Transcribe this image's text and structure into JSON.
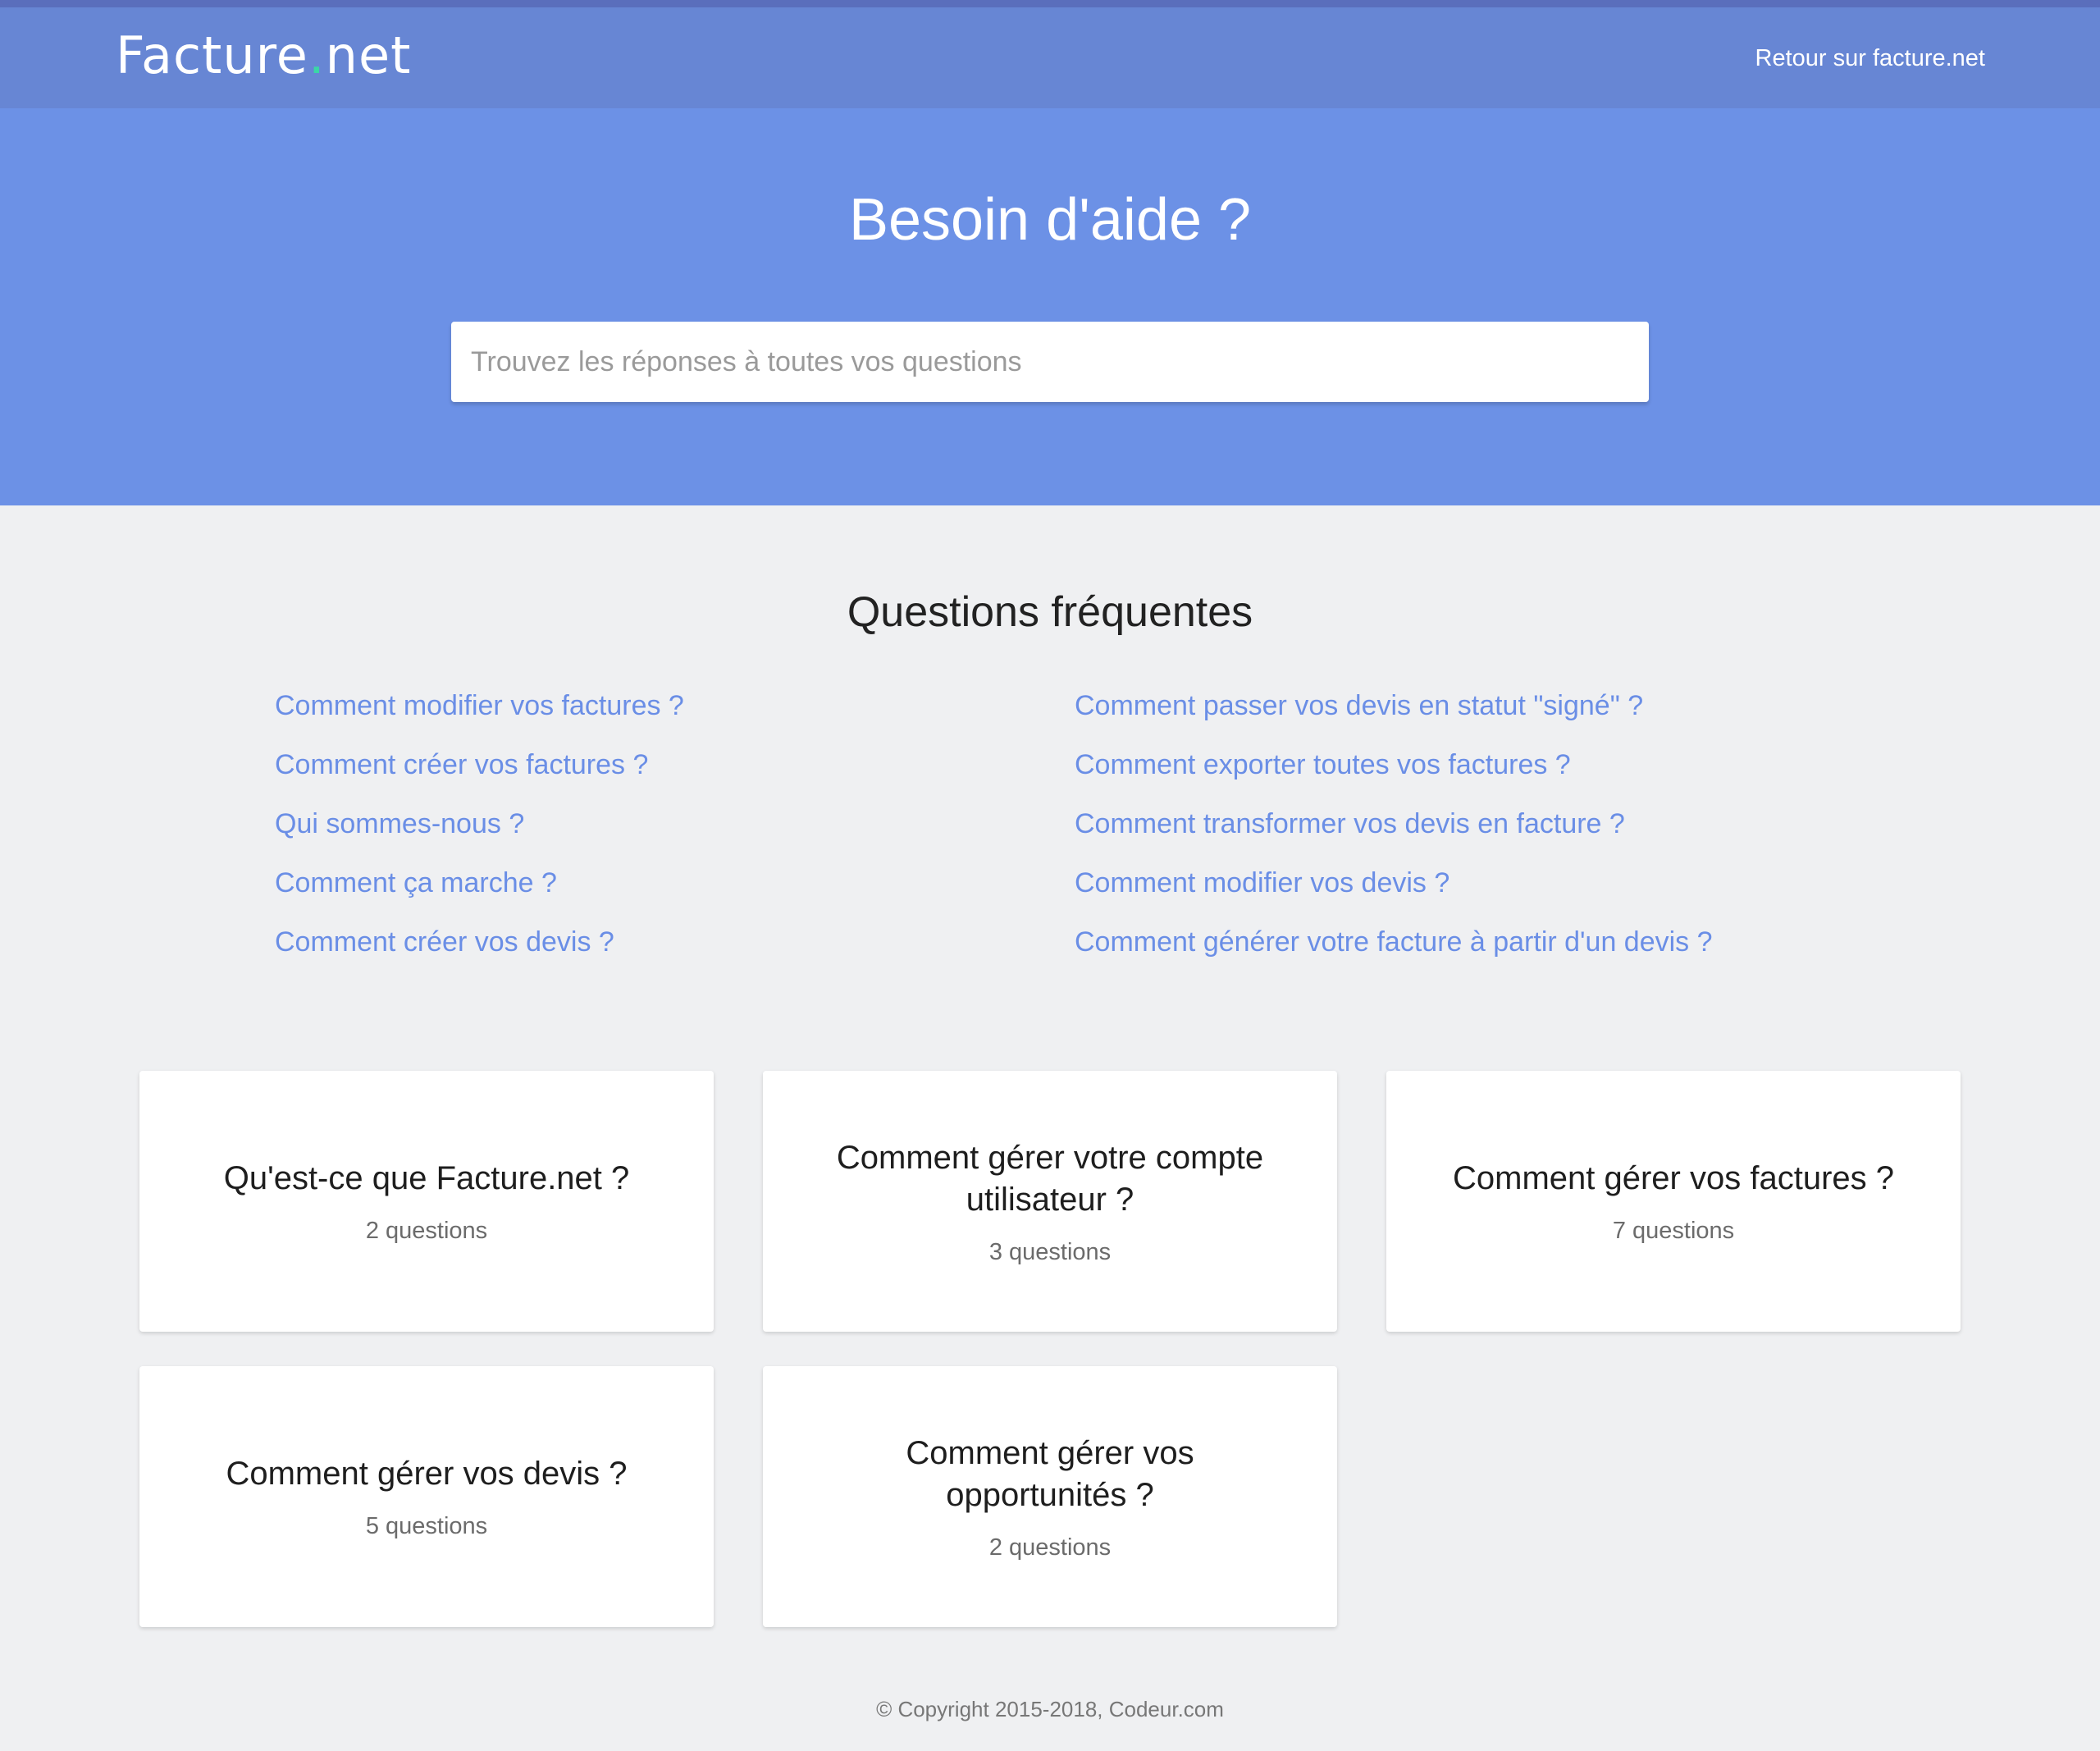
{
  "header": {
    "logo_main": "Facture",
    "logo_dot": ".",
    "logo_tld": "net",
    "back_link": "Retour sur facture.net"
  },
  "hero": {
    "title": "Besoin d'aide ?",
    "search_placeholder": "Trouvez les réponses à toutes vos questions"
  },
  "faq": {
    "title": "Questions fréquentes",
    "left": [
      "Comment modifier vos factures ?",
      "Comment créer vos factures ?",
      "Qui sommes-nous ?",
      "Comment ça marche ?",
      "Comment créer vos devis ?"
    ],
    "right": [
      "Comment passer vos devis en statut \"signé\" ?",
      "Comment exporter toutes vos factures ?",
      "Comment transformer vos devis en facture ?",
      "Comment modifier vos devis ?",
      "Comment générer votre facture à partir d'un devis ?"
    ]
  },
  "categories": [
    {
      "title": "Qu'est-ce que Facture.net ?",
      "count": "2 questions"
    },
    {
      "title": "Comment gérer votre compte utilisateur ?",
      "count": "3 questions"
    },
    {
      "title": "Comment gérer vos factures ?",
      "count": "7 questions"
    },
    {
      "title": "Comment gérer vos devis ?",
      "count": "5 questions"
    },
    {
      "title": "Comment gérer vos opportunités ?",
      "count": "2 questions"
    }
  ],
  "footer": {
    "copyright": "© Copyright 2015-2018, Codeur.com"
  },
  "colors": {
    "navbar": "#6786d4",
    "hero": "#6c91e6",
    "link": "#6a8ee6",
    "logo_dot": "#3bd6a6",
    "background": "#eff0f2"
  }
}
